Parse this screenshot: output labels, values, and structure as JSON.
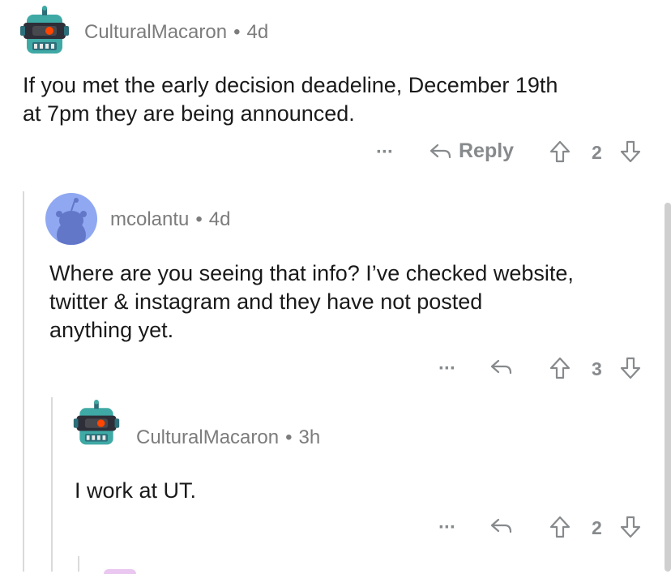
{
  "comments": [
    {
      "username": "CulturalMacaron",
      "separator": "•",
      "age": "4d",
      "text_lines": [
        "If you met the early decision deadeline, December 19th",
        "at 7pm they are being announced."
      ],
      "reply_label": "Reply",
      "votes": "2"
    },
    {
      "username": "mcolantu",
      "separator": "•",
      "age": "4d",
      "text_lines": [
        "Where are you seeing that info? I’ve checked website,",
        "twitter & instagram and they have not posted",
        "anything yet."
      ],
      "votes": "3"
    },
    {
      "username": "CulturalMacaron",
      "separator": "•",
      "age": "3h",
      "text_lines": [
        "I work at UT."
      ],
      "votes": "2"
    }
  ],
  "more_label": "···",
  "icons": {
    "reply": "reply-arrow-icon",
    "upvote": "upvote-arrow-icon",
    "downvote": "downvote-arrow-icon",
    "more": "more-options-icon"
  },
  "colors": {
    "meta_gray": "#7c7c7c",
    "icon_gray": "#878a8c",
    "thread_line": "#dadada",
    "robot_teal": "#39a3a0",
    "default_avatar": "#8fa8f1"
  }
}
